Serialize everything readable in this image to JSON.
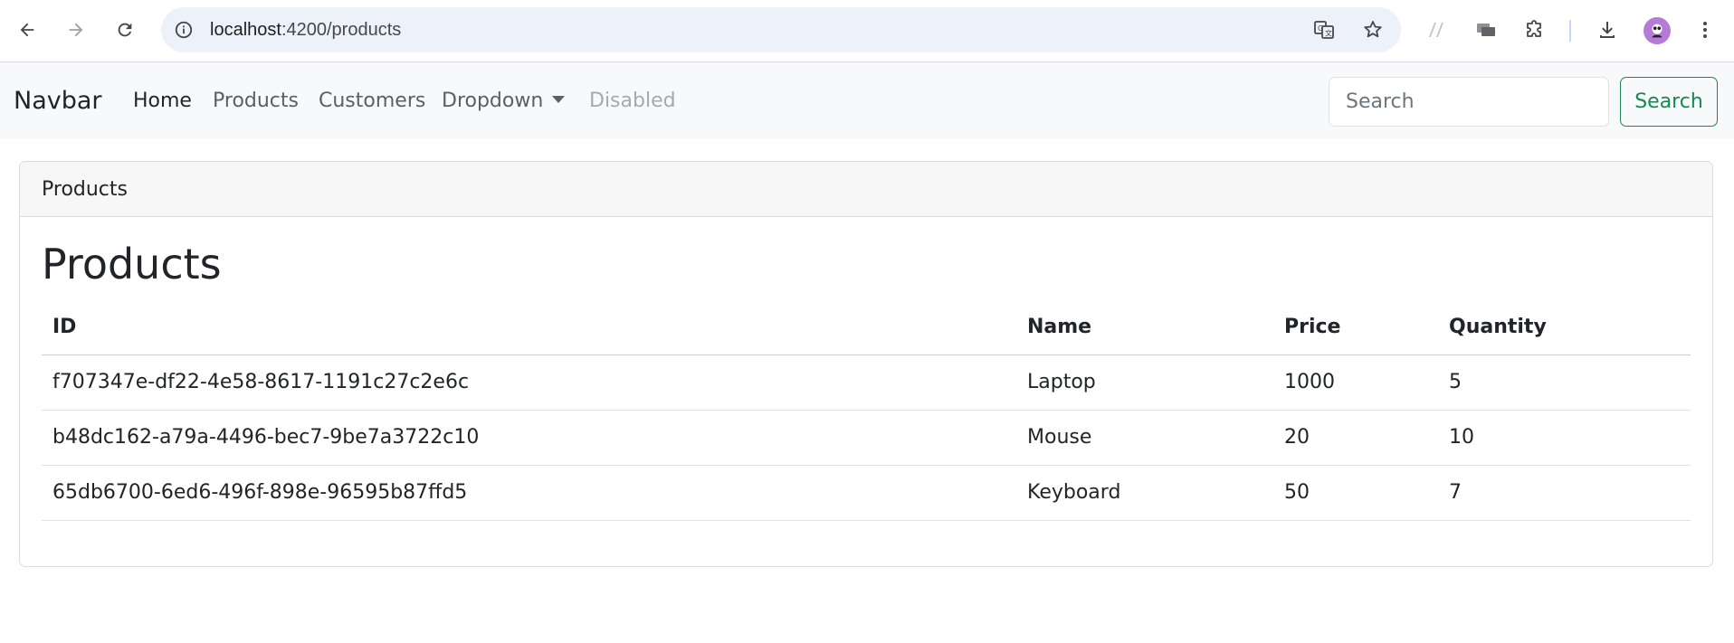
{
  "browser": {
    "url_host": "localhost",
    "url_path": ":4200/products"
  },
  "navbar": {
    "brand": "Navbar",
    "links": [
      {
        "label": "Home",
        "state": "active"
      },
      {
        "label": "Products",
        "state": "normal"
      },
      {
        "label": "Customers",
        "state": "normal"
      },
      {
        "label": "Dropdown",
        "state": "normal"
      },
      {
        "label": "Disabled",
        "state": "disabled"
      }
    ],
    "search": {
      "placeholder": "Search",
      "value": ""
    },
    "search_button": "Search",
    "search_button_color": "#198754"
  },
  "card": {
    "header": "Products",
    "title": "Products",
    "table": {
      "columns": [
        "ID",
        "Name",
        "Price",
        "Quantity"
      ],
      "rows": [
        [
          "f707347e-df22-4e58-8617-1191c27c2e6c",
          "Laptop",
          "1000",
          "5"
        ],
        [
          "b48dc162-a79a-4496-bec7-9be7a3722c10",
          "Mouse",
          "20",
          "10"
        ],
        [
          "65db6700-6ed6-496f-898e-96595b87ffd5",
          "Keyboard",
          "50",
          "7"
        ]
      ]
    }
  }
}
